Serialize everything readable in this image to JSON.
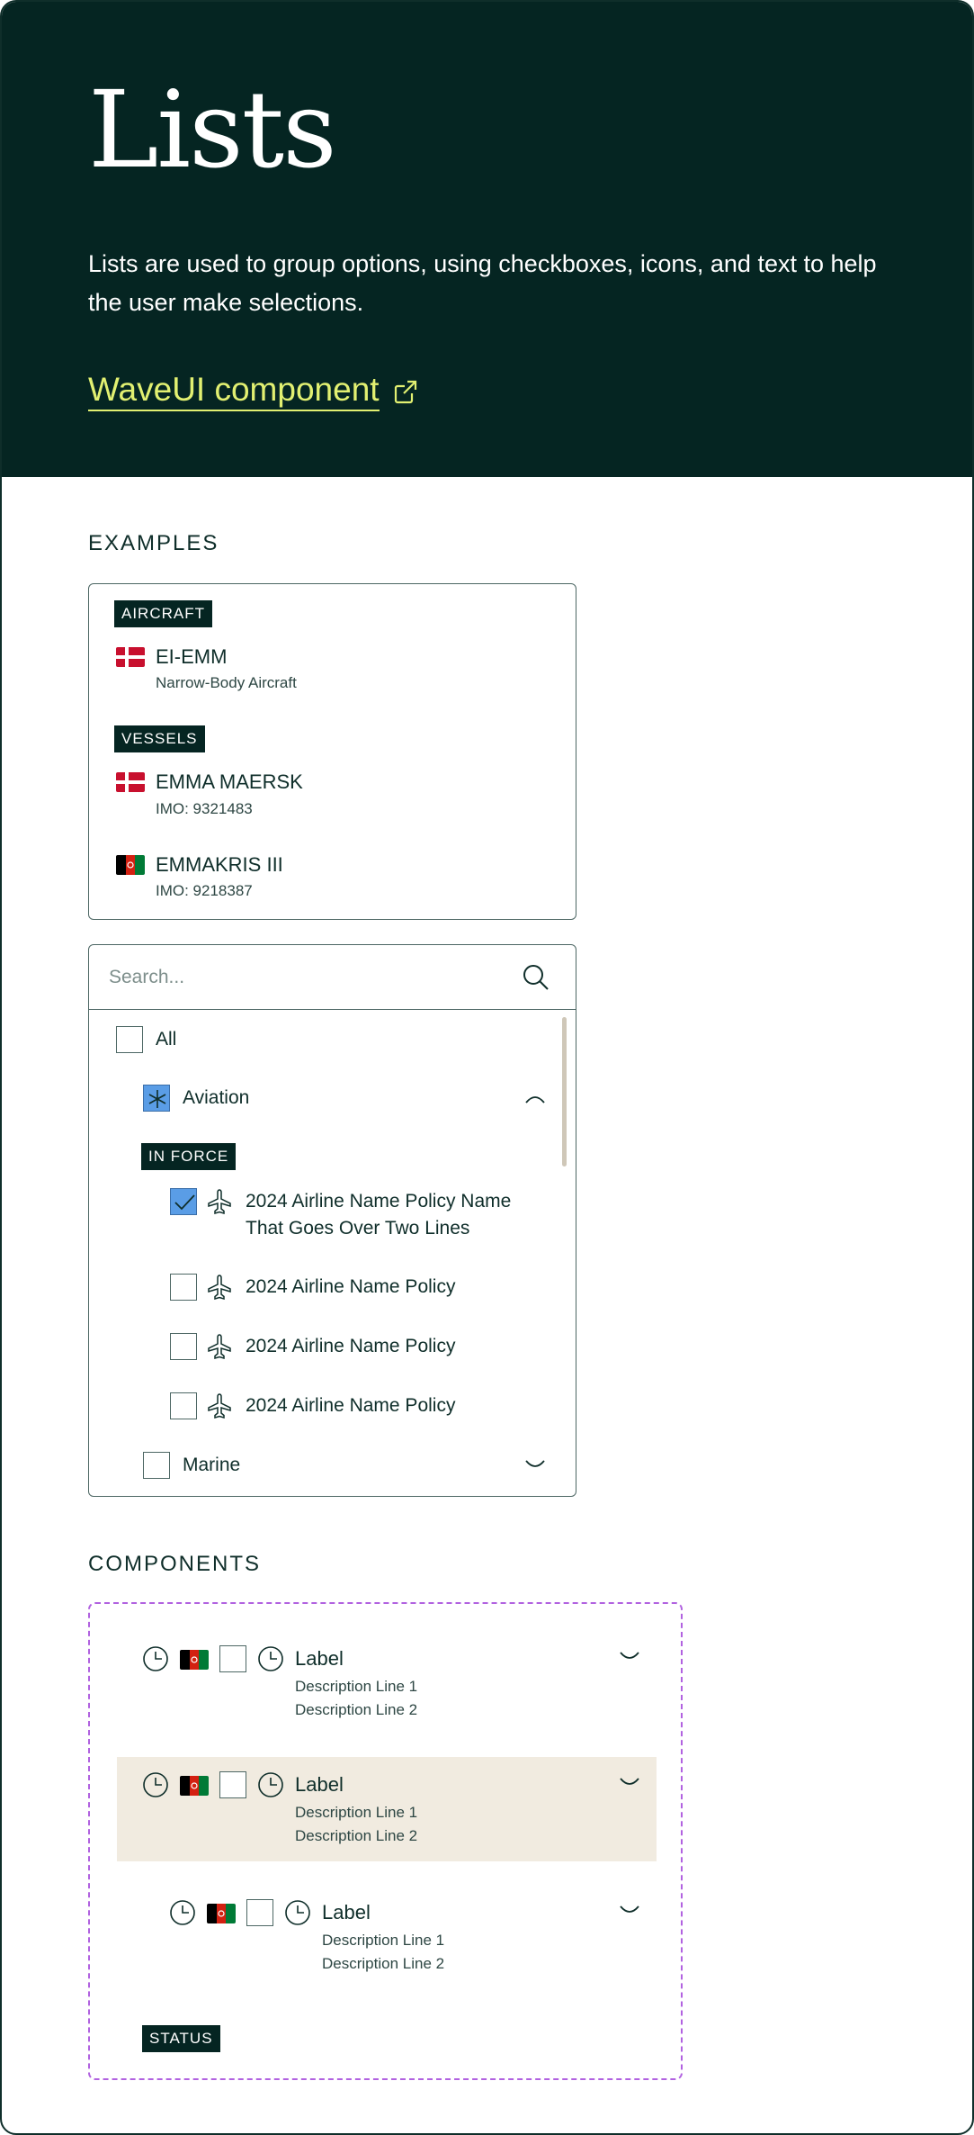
{
  "hero": {
    "title": "Lists",
    "description": "Lists are used to group options, using checkboxes, icons, and text to help the user make selections.",
    "link_label": "WaveUI component"
  },
  "examples": {
    "heading": "EXAMPLES",
    "card1": {
      "groups": [
        {
          "badge": "AIRCRAFT",
          "items": [
            {
              "flag": "denmark",
              "title": "EI-EMM",
              "subtitle": "Narrow-Body Aircraft"
            }
          ]
        },
        {
          "badge": "VESSELS",
          "items": [
            {
              "flag": "denmark",
              "title": "EMMA MAERSK",
              "subtitle": "IMO: 9321483"
            },
            {
              "flag": "afghanistan",
              "title": "EMMAKRIS III",
              "subtitle": "IMO: 9218387"
            }
          ]
        }
      ]
    },
    "card2": {
      "search_placeholder": "Search...",
      "all_label": "All",
      "aviation_label": "Aviation",
      "status_badge": "IN FORCE",
      "policies": [
        {
          "line1": "2024 Airline Name Policy Name",
          "line2": "That Goes Over Two Lines",
          "checked": true
        },
        {
          "line1": "2024 Airline Name Policy",
          "checked": false
        },
        {
          "line1": "2024 Airline Name Policy",
          "checked": false
        },
        {
          "line1": "2024 Airline Name Policy",
          "checked": false
        }
      ],
      "marine_label": "Marine"
    }
  },
  "components": {
    "heading": "COMPONENTS",
    "rows": [
      {
        "label": "Label",
        "desc1": "Description Line 1",
        "desc2": "Description Line 2",
        "highlighted": false,
        "indent": 0
      },
      {
        "label": "Label",
        "desc1": "Description Line 1",
        "desc2": "Description Line 2",
        "highlighted": true,
        "indent": 0
      },
      {
        "label": "Label",
        "desc1": "Description Line 1",
        "desc2": "Description Line 2",
        "highlighted": false,
        "indent": 1
      }
    ],
    "status_badge": "STATUS"
  },
  "colors": {
    "hero_bg": "#052522",
    "link_accent": "#e2f071",
    "checkbox_checked": "#5a9de6",
    "highlight_row": "#f1ebe0",
    "component_border": "#b162e0"
  },
  "icons": [
    "external-link-icon",
    "search-icon",
    "chevron-up-icon",
    "chevron-down-icon",
    "airplane-icon",
    "clock-icon",
    "denmark-flag-icon",
    "afghanistan-flag-icon"
  ]
}
